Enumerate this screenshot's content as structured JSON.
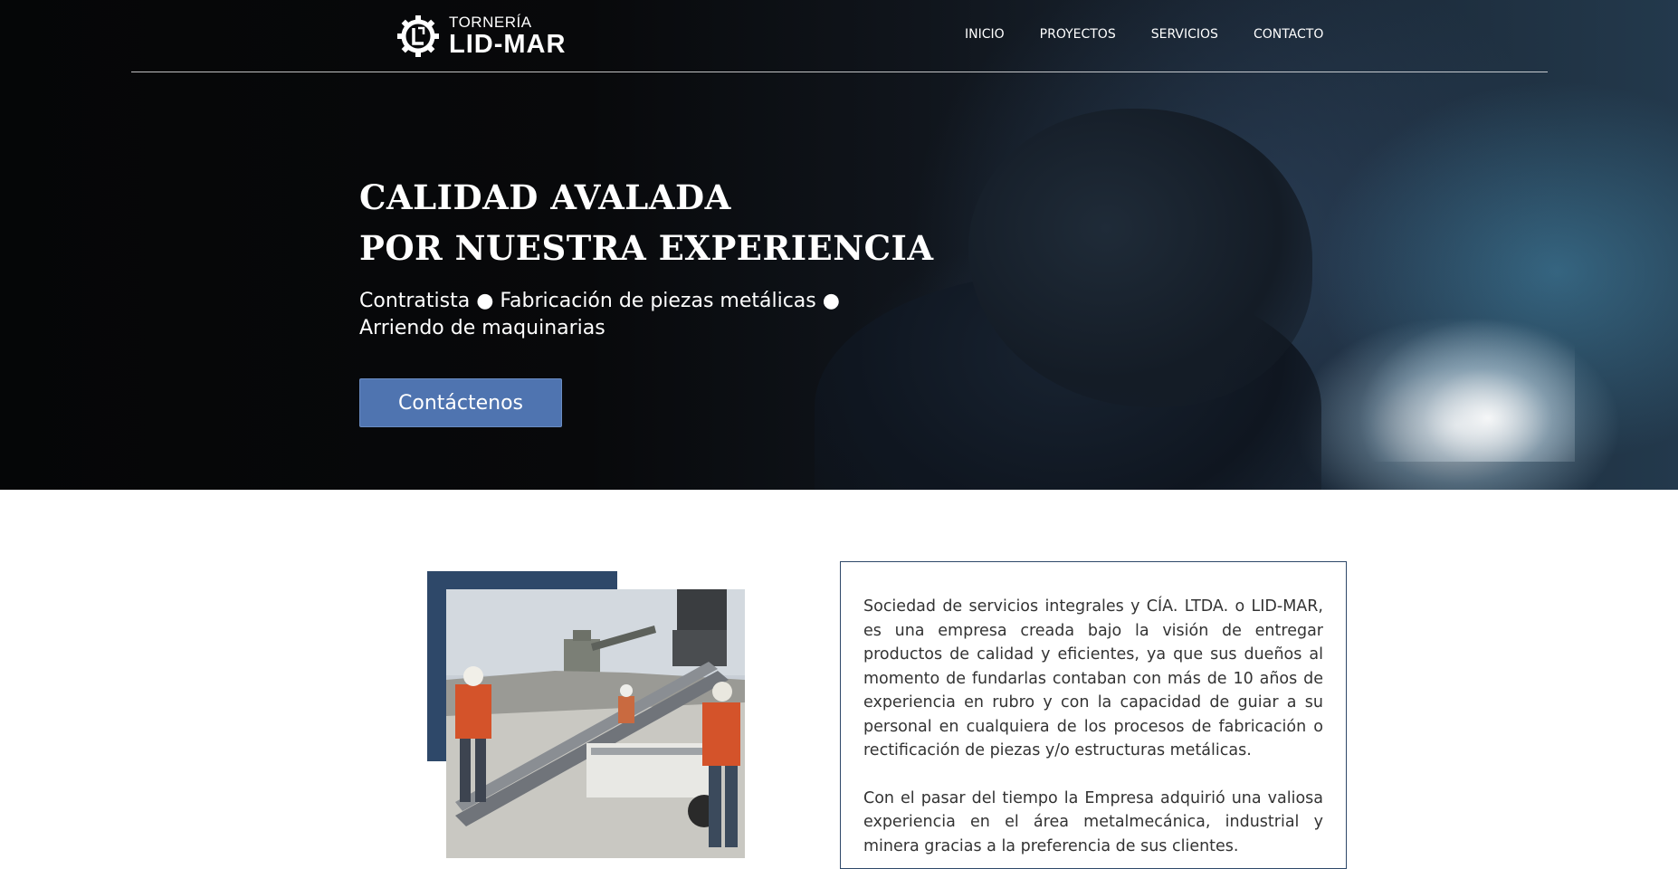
{
  "brand": {
    "name_small": "TORNERÍA",
    "name_big": "LID-MAR"
  },
  "nav": {
    "items": [
      {
        "label": "INICIO"
      },
      {
        "label": "PROYECTOS"
      },
      {
        "label": "SERVICIOS"
      },
      {
        "label": "CONTACTO"
      }
    ]
  },
  "hero": {
    "title_line1": "CALIDAD AVALADA",
    "title_line2": "POR NUESTRA EXPERIENCIA",
    "subtitle_line1": "Contratista ● Fabricación de piezas metálicas ●",
    "subtitle_line2": "Arriendo de maquinarias",
    "cta_label": "Contáctenos"
  },
  "about": {
    "paragraph1": "Sociedad de servicios integrales y CÍA. LTDA. o LID-MAR, es una empresa creada bajo la visión de entregar productos de calidad y eficientes, ya que sus dueños al momento de fundarlas contaban con más de 10 años de experiencia en rubro y con la capacidad de guiar a su personal en cualquiera de los procesos de fabricación o rectificación de piezas y/o estructuras metálicas.",
    "paragraph2": "Con el pasar del tiempo la Empresa adquirió una valiosa experiencia en el área metalmecánica, industrial y minera gracias a la preferencia de sus clientes."
  },
  "colors": {
    "accent_button": "#4f74b0",
    "frame_navy": "#2e4869",
    "body_text": "#333333"
  },
  "icons": {
    "logo": "gear-logo-icon"
  }
}
